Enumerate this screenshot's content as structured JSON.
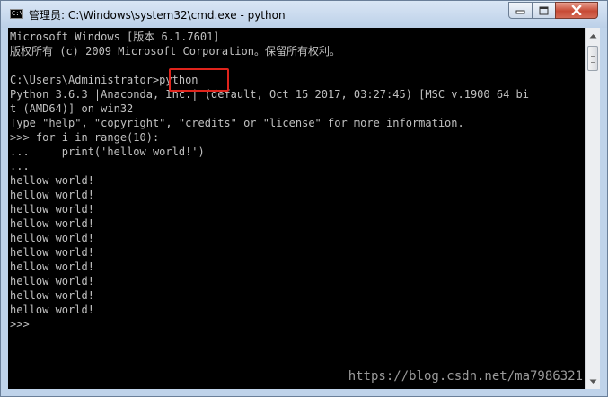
{
  "window": {
    "title": "管理员: C:\\Windows\\system32\\cmd.exe - python",
    "icon_text": "C:\\"
  },
  "controls": {
    "minimize_icon": "minimize-icon",
    "maximize_icon": "maximize-icon",
    "close_icon": "close-icon"
  },
  "console": {
    "lines": [
      "Microsoft Windows [版本 6.1.7601]",
      "版权所有 (c) 2009 Microsoft Corporation。保留所有权利。",
      "",
      "C:\\Users\\Administrator>python",
      "Python 3.6.3 |Anaconda, Inc.| (default, Oct 15 2017, 03:27:45) [MSC v.1900 64 bi",
      "t (AMD64)] on win32",
      "Type \"help\", \"copyright\", \"credits\" or \"license\" for more information.",
      ">>> for i in range(10):",
      "...     print('hellow world!')",
      "...",
      "hellow world!",
      "hellow world!",
      "hellow world!",
      "hellow world!",
      "hellow world!",
      "hellow world!",
      "hellow world!",
      "hellow world!",
      "hellow world!",
      "hellow world!",
      ">>>"
    ]
  },
  "watermark": "https://blog.csdn.net/ma7986321",
  "colors": {
    "console_bg": "#000000",
    "console_text": "#c0c0c0",
    "highlight": "#e0241c"
  }
}
